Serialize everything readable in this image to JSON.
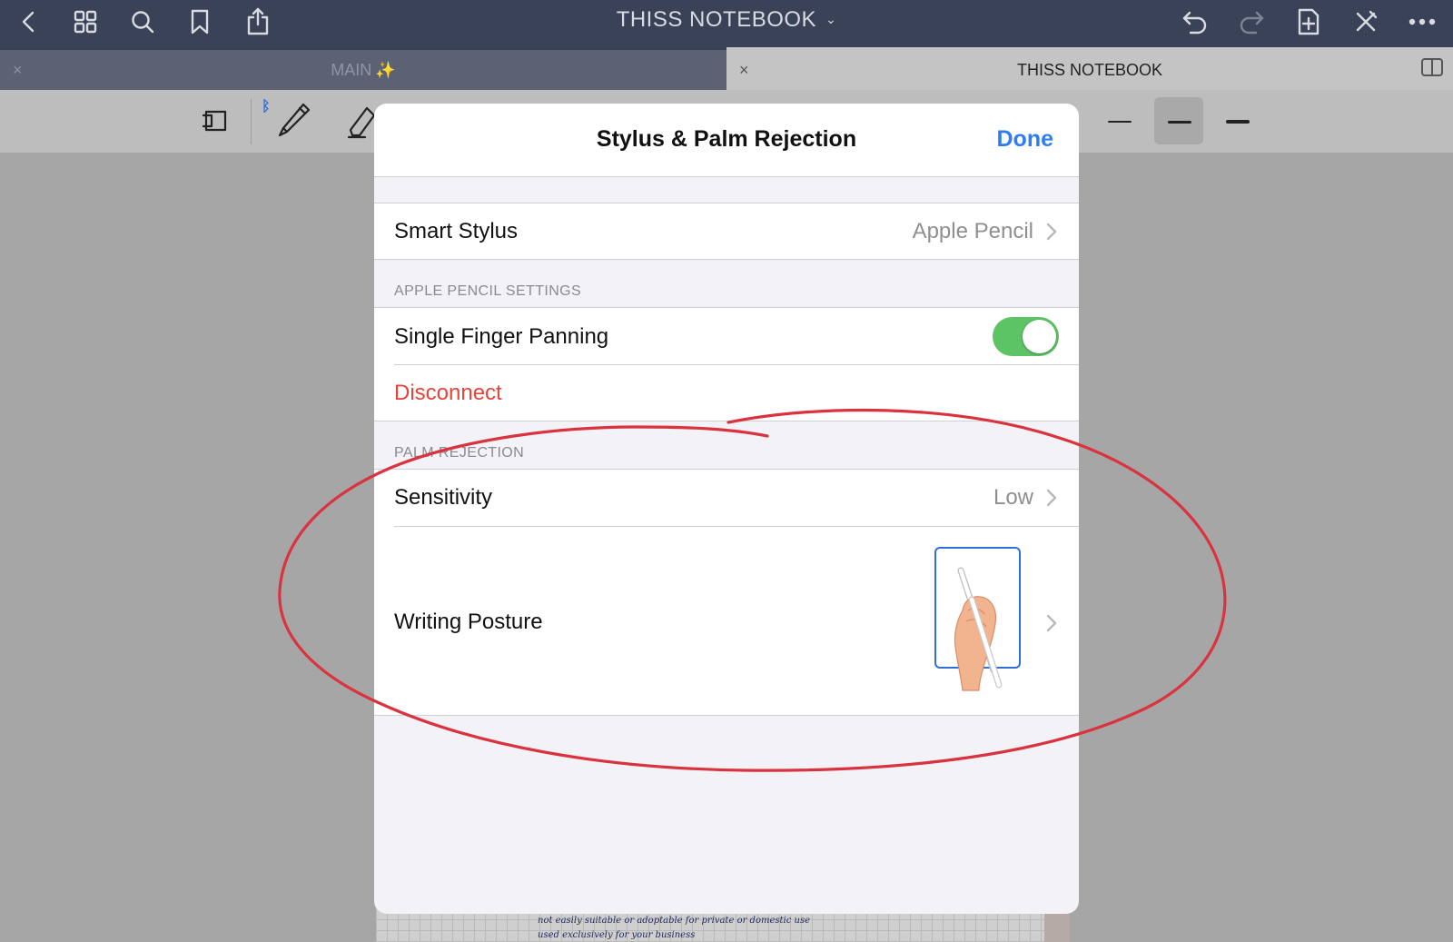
{
  "app": {
    "title": "THISS NOTEBOOK",
    "title_caret": "⌄"
  },
  "top_icons": [
    "back-icon",
    "grid-icon",
    "search-icon",
    "bookmark-icon",
    "share-icon",
    "undo-icon",
    "redo-icon",
    "add-page-icon",
    "close-x-icon",
    "more-icon"
  ],
  "tabs": [
    {
      "label": "MAIN",
      "emoji": "✨",
      "close": "×",
      "active": false
    },
    {
      "label": "THISS NOTEBOOK",
      "close": "×",
      "active": true
    }
  ],
  "toolbar": {
    "bluetooth_glyph": "ᛒ",
    "selected_stroke": "medium"
  },
  "modal": {
    "title": "Stylus & Palm Rejection",
    "done_label": "Done",
    "smart_stylus": {
      "label": "Smart Stylus",
      "value": "Apple Pencil"
    },
    "apple_pencil_section": "APPLE PENCIL SETTINGS",
    "single_finger_panning": {
      "label": "Single Finger Panning",
      "enabled": true
    },
    "disconnect_label": "Disconnect",
    "palm_rejection_section": "PALM REJECTION",
    "sensitivity": {
      "label": "Sensitivity",
      "value": "Low"
    },
    "writing_posture": {
      "label": "Writing Posture"
    }
  },
  "page_notes": [
    "not easily suitable or adoptable for private or domestic use",
    "used exclusively for your business"
  ],
  "colors": {
    "nav_bar": "#3a4257",
    "accent_blue": "#2f7cf6",
    "toggle_on": "#5dc466",
    "destructive_red": "#e5443a",
    "annotation_red": "#d9333f"
  }
}
